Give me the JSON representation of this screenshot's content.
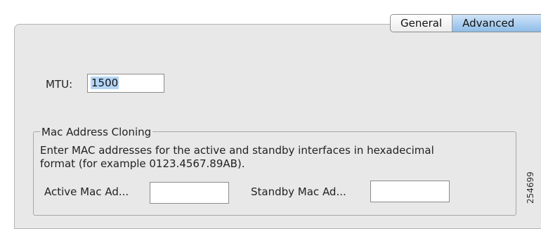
{
  "tabs": [
    {
      "label": "General",
      "active": false
    },
    {
      "label": "Advanced",
      "active": true
    }
  ],
  "mtu": {
    "label": "MTU:",
    "value": "1500"
  },
  "mac_cloning": {
    "title": "Mac Address Cloning",
    "description_line1": "Enter MAC addresses for the active and standby interfaces in hexadecimal",
    "description_line2": "format (for example 0123.4567.89AB).",
    "active_label": "Active Mac Ad...",
    "active_value": "",
    "standby_label": "Standby Mac Ad...",
    "standby_value": ""
  },
  "figure_id": "254699",
  "colors": {
    "panel_bg": "#e8e8e8",
    "selected_tab": "#8fbde8",
    "text_selection": "#b5d5f5"
  }
}
